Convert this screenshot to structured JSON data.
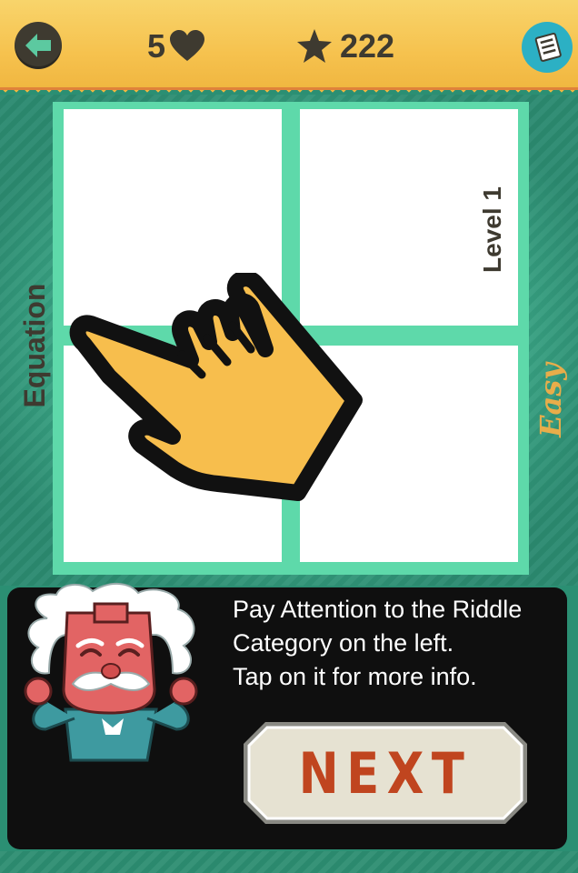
{
  "header": {
    "lives": "5",
    "stars": "222",
    "icons": {
      "back": "back-arrow-icon",
      "lives": "heart-icon",
      "stars": "star-icon",
      "menu": "menu-list-icon"
    },
    "colors": {
      "bar": "#f6c24e",
      "text": "#3e3a30",
      "menu": "#2cb0c4",
      "back_arrow": "#5cc9a0"
    }
  },
  "puzzle": {
    "category": "Equation",
    "level": "Level 1",
    "difficulty": "Easy",
    "tiles": 4,
    "colors": {
      "background": "#3fae8c",
      "frame": "#5ed9aa",
      "tile": "#ffffff",
      "difficulty": "#e8ad4a"
    }
  },
  "tutorial": {
    "lines": [
      "Pay Attention to the Riddle",
      "Category on the left.",
      "Tap on it for more info."
    ],
    "next_label": "NEXT",
    "icons": {
      "pointer": "pointing-hand-icon",
      "mascot": "professor-mascot"
    },
    "colors": {
      "panel": "#0f0f0f",
      "button": "#e6e2d2",
      "button_text": "#c0451f"
    }
  }
}
